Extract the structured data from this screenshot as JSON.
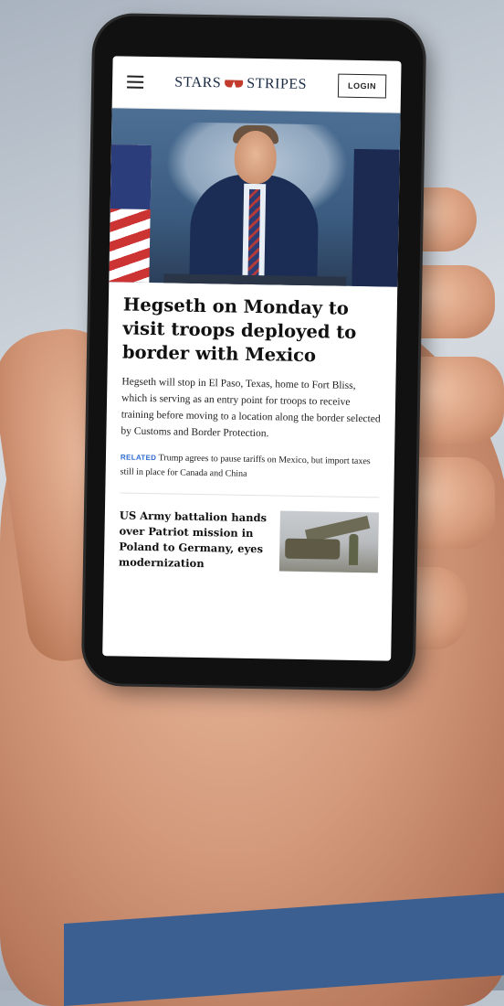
{
  "header": {
    "logo_text_left": "STARS",
    "logo_text_right": "STRIPES",
    "login_label": "LOGIN"
  },
  "main_article": {
    "headline": "Hegseth on Monday to visit troops deployed to border with Mexico",
    "summary": "Hegseth will stop in El Paso, Texas, home to Fort Bliss, which is serving as an entry point for troops to receive training before moving to a location along the border selected by Customs and Border Protection.",
    "related_tag": "RELATED",
    "related_text": "Trump agrees to pause tariffs on Mexico, but import taxes still in place for Canada and China"
  },
  "secondary_article": {
    "title": "US Army battalion hands over Patriot mission in Poland to Germany, eyes modernization"
  },
  "colors": {
    "brand_navy": "#1b2b44",
    "brand_red": "#c23a2c",
    "related_blue": "#2d6bd1",
    "band_blue": "#3b5f91"
  },
  "icons": {
    "menu": "hamburger-menu-icon",
    "logo_mark": "stars-stripes-flag-mark"
  }
}
